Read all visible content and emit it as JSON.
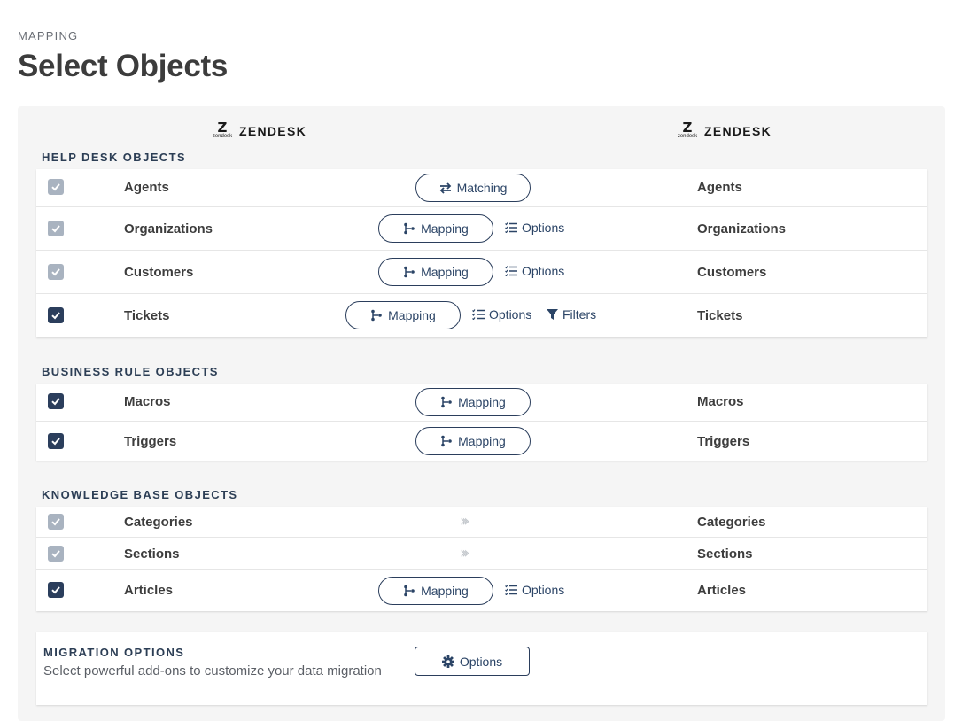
{
  "header": {
    "eyebrow": "MAPPING",
    "title": "Select Objects"
  },
  "platforms": {
    "source": {
      "logo_small": "zendesk",
      "name": "ZENDESK"
    },
    "target": {
      "logo_small": "zendesk",
      "name": "ZENDESK"
    }
  },
  "sections": {
    "help_desk": {
      "title": "HELP DESK OBJECTS",
      "rows": [
        {
          "source": "Agents",
          "target": "Agents",
          "checkbox": "checked-disabled",
          "primary": "Matching"
        },
        {
          "source": "Organizations",
          "target": "Organizations",
          "checkbox": "checked-disabled",
          "primary": "Mapping",
          "options": "Options"
        },
        {
          "source": "Customers",
          "target": "Customers",
          "checkbox": "checked-disabled",
          "primary": "Mapping",
          "options": "Options"
        },
        {
          "source": "Tickets",
          "target": "Tickets",
          "checkbox": "checked",
          "primary": "Mapping",
          "options": "Options",
          "filters": "Filters"
        }
      ]
    },
    "business_rule": {
      "title": "BUSINESS RULE OBJECTS",
      "rows": [
        {
          "source": "Macros",
          "target": "Macros",
          "checkbox": "checked",
          "primary": "Mapping"
        },
        {
          "source": "Triggers",
          "target": "Triggers",
          "checkbox": "checked",
          "primary": "Mapping"
        }
      ]
    },
    "knowledge_base": {
      "title": "KNOWLEDGE BASE OBJECTS",
      "rows": [
        {
          "source": "Categories",
          "target": "Categories",
          "checkbox": "checked-disabled"
        },
        {
          "source": "Sections",
          "target": "Sections",
          "checkbox": "checked-disabled"
        },
        {
          "source": "Articles",
          "target": "Articles",
          "checkbox": "checked",
          "primary": "Mapping",
          "options": "Options"
        }
      ]
    }
  },
  "migration_options": {
    "title": "MIGRATION OPTIONS",
    "subtitle": "Select powerful add-ons to customize your data migration",
    "button": "Options"
  },
  "colors": {
    "accent": "#2b3e5c",
    "disabled_checkbox": "#a9b3c0",
    "panel_bg": "#f5f5f5"
  }
}
